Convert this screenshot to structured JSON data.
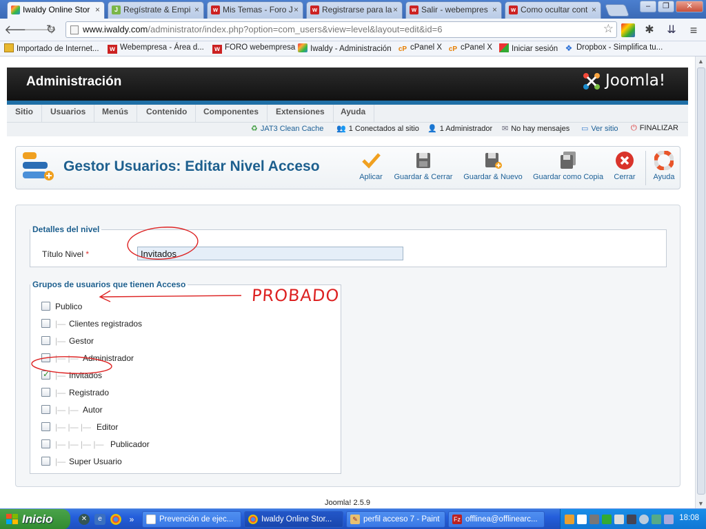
{
  "browser": {
    "tabs": [
      {
        "label": "Iwaldy Online Stor",
        "active": true,
        "favicon": "joomla-icon"
      },
      {
        "label": "Regístrate & Empi",
        "favicon": "j-icon"
      },
      {
        "label": "Mis Temas - Foro J",
        "favicon": "webempresa-icon"
      },
      {
        "label": "Registrarse para la",
        "favicon": "webempresa-icon"
      },
      {
        "label": "Salir - webempres",
        "favicon": "webempresa-icon"
      },
      {
        "label": "Como ocultar cont",
        "favicon": "webempresa-icon"
      }
    ],
    "url_host": "www.iwaldy.com",
    "url_path": "/administrator/index.php?option=com_users&view=level&layout=edit&id=6",
    "bookmarks": [
      "Importado de Internet...",
      "Webempresa - Área d...",
      "FORO webempresa",
      "Iwaldy - Administración",
      "cPanel X",
      "cPanel X",
      "Iniciar sesión",
      "Dropbox - Simplifica tu..."
    ]
  },
  "joomla": {
    "header_title": "Administración",
    "logo_text": "Joomla!",
    "menu": [
      "Sitio",
      "Usuarios",
      "Menús",
      "Contenido",
      "Componentes",
      "Extensiones",
      "Ayuda"
    ],
    "status": {
      "cache": "JAT3 Clean Cache",
      "online": "1 Conectados al sitio",
      "admins": "1 Administrador",
      "messages": "No hay mensajes",
      "view_site": "Ver sitio",
      "logout": "FINALIZAR"
    },
    "page_title": "Gestor Usuarios: Editar Nivel Acceso",
    "toolbar": {
      "apply": "Aplicar",
      "save_close": "Guardar & Cerrar",
      "save_new": "Guardar & Nuevo",
      "save_copy": "Guardar como Copia",
      "close": "Cerrar",
      "help": "Ayuda"
    },
    "details_legend": "Detalles del nivel",
    "title_label": "Título Nivel",
    "required_mark": "*",
    "title_value": "Invitados",
    "groups_legend": "Grupos de usuarios que tienen Acceso",
    "groups": [
      {
        "name": "Publico",
        "depth": 0,
        "checked": false
      },
      {
        "name": "Clientes registrados",
        "depth": 1,
        "checked": false
      },
      {
        "name": "Gestor",
        "depth": 1,
        "checked": false
      },
      {
        "name": "Administrador",
        "depth": 2,
        "checked": false
      },
      {
        "name": "Invitados",
        "depth": 1,
        "checked": true
      },
      {
        "name": "Registrado",
        "depth": 1,
        "checked": false
      },
      {
        "name": "Autor",
        "depth": 2,
        "checked": false
      },
      {
        "name": "Editor",
        "depth": 3,
        "checked": false
      },
      {
        "name": "Publicador",
        "depth": 4,
        "checked": false
      },
      {
        "name": "Super Usuario",
        "depth": 1,
        "checked": false
      }
    ],
    "annotation": "PROBADO",
    "footer": "Joomla! 2.5.9"
  },
  "taskbar": {
    "start": "Inicio",
    "tasks": [
      {
        "label": "Prevención de ejec...",
        "active": false
      },
      {
        "label": "Iwaldy Online Stor...",
        "active": true
      },
      {
        "label": "perfil acceso 7 - Paint",
        "active": false
      },
      {
        "label": "offlinea@offlinearc...",
        "active": false
      }
    ],
    "clock": "18:08"
  },
  "colors": {
    "joomla_blue": "#1d5f8e",
    "annotation_red": "#d22222",
    "taskbar_blue": "#245edb",
    "start_green": "#3a963a"
  }
}
